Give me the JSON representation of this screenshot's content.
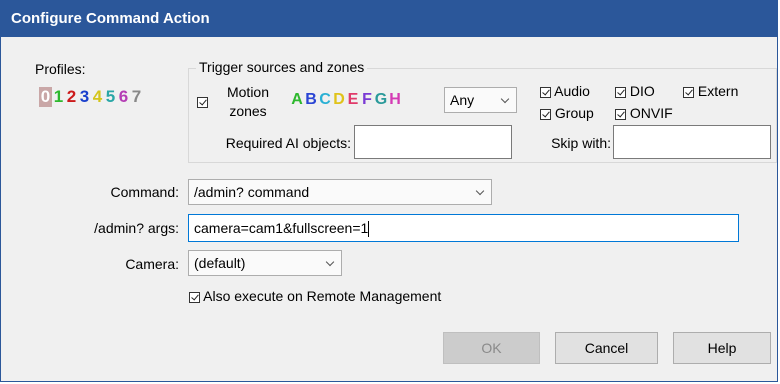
{
  "window": {
    "title": "Configure Command Action"
  },
  "profiles": {
    "label": "Profiles:",
    "items": [
      {
        "text": "0",
        "color": "#b08a8a"
      },
      {
        "text": "1",
        "color": "#2eb82e"
      },
      {
        "text": "2",
        "color": "#cc1a1a"
      },
      {
        "text": "3",
        "color": "#1a3fcc"
      },
      {
        "text": "4",
        "color": "#d4c51a"
      },
      {
        "text": "5",
        "color": "#2aa7a7"
      },
      {
        "text": "6",
        "color": "#b43cb4"
      },
      {
        "text": "7",
        "color": "#888888"
      }
    ]
  },
  "trigger": {
    "group_title": "Trigger sources and zones",
    "motion_label_line1": "Motion",
    "motion_label_line2": "zones",
    "zones": [
      {
        "text": "A",
        "color": "#2eb82e"
      },
      {
        "text": "B",
        "color": "#2a45d4"
      },
      {
        "text": "C",
        "color": "#2ab0d4"
      },
      {
        "text": "D",
        "color": "#e0c31a"
      },
      {
        "text": "E",
        "color": "#e03a6a"
      },
      {
        "text": "F",
        "color": "#7a3ad4"
      },
      {
        "text": "G",
        "color": "#2a9a9a"
      },
      {
        "text": "H",
        "color": "#d43ab4"
      }
    ],
    "zone_mode": "Any",
    "audio_label": "Audio",
    "dio_label": "DIO",
    "extern_label": "Extern",
    "group_label": "Group",
    "onvif_label": "ONVIF",
    "ai_label": "Required AI objects:",
    "ai_value": "",
    "skip_label": "Skip with:",
    "skip_value": ""
  },
  "form": {
    "command_label": "Command:",
    "command_value": "/admin? command",
    "args_label": "/admin? args:",
    "args_value": "camera=cam1&fullscreen=1",
    "camera_label": "Camera:",
    "camera_value": "(default)",
    "remote_label": "Also execute on Remote Management"
  },
  "buttons": {
    "ok": "OK",
    "cancel": "Cancel",
    "help": "Help"
  }
}
